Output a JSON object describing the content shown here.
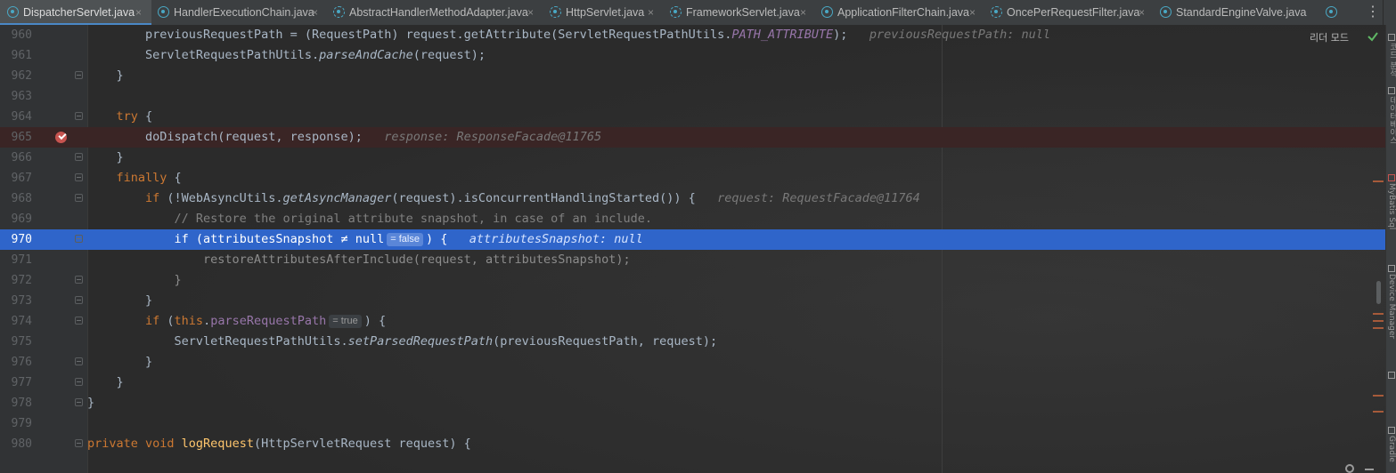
{
  "tabs": [
    {
      "label": "DispatcherServlet.java",
      "close": "×",
      "active": true
    },
    {
      "label": "HandlerExecutionChain.java",
      "close": "×"
    },
    {
      "label": "AbstractHandlerMethodAdapter.java",
      "close": "×"
    },
    {
      "label": "HttpServlet.java",
      "close": "×"
    },
    {
      "label": "FrameworkServlet.java",
      "close": "×"
    },
    {
      "label": "ApplicationFilterChain.java",
      "close": "×"
    },
    {
      "label": "OncePerRequestFilter.java",
      "close": "×"
    },
    {
      "label": "StandardEngineValve.java",
      "close": ""
    }
  ],
  "tab_more": "⋮",
  "reader_mode": "리더 모드",
  "side_labels": [
    "코드 분석",
    "데이터베이스",
    "MyBatis Sql",
    "Device Manager",
    "Gradle"
  ],
  "lines": [
    {
      "num": "960",
      "tokens": [
        [
          "",
          "        previousRequestPath = (RequestPath) request.getAttribute(ServletRequestPathUtils."
        ],
        [
          "const",
          "PATH_ATTRIBUTE"
        ],
        [
          "",
          ");"
        ]
      ],
      "hint": "previousRequestPath: null"
    },
    {
      "num": "961",
      "tokens": [
        [
          "",
          "        ServletRequestPathUtils."
        ],
        [
          "it",
          "parseAndCache"
        ],
        [
          "",
          "(request);"
        ]
      ]
    },
    {
      "num": "962",
      "tokens": [
        [
          "",
          "    }"
        ]
      ]
    },
    {
      "num": "963",
      "tokens": []
    },
    {
      "num": "964",
      "tokens": [
        [
          "kw",
          "    try"
        ],
        [
          "",
          " {"
        ]
      ]
    },
    {
      "num": "965",
      "tokens": [
        [
          "",
          "        doDispatch(request, response);"
        ]
      ],
      "hint": "response: ResponseFacade@11765",
      "breakpoint": true
    },
    {
      "num": "966",
      "tokens": [
        [
          "",
          "    }"
        ]
      ]
    },
    {
      "num": "967",
      "tokens": [
        [
          "kw",
          "    finally"
        ],
        [
          "",
          " {"
        ]
      ]
    },
    {
      "num": "968",
      "tokens": [
        [
          "kw",
          "        if"
        ],
        [
          "",
          " (!WebAsyncUtils."
        ],
        [
          "it",
          "getAsyncManager"
        ],
        [
          "",
          "(request).isConcurrentHandlingStarted()) {"
        ]
      ],
      "hint": "request: RequestFacade@11764"
    },
    {
      "num": "969",
      "tokens": [
        [
          "cmt",
          "            // Restore the original attribute snapshot, in case of an include."
        ]
      ]
    },
    {
      "num": "970",
      "tokens": [
        [
          "kw",
          "            if"
        ],
        [
          "",
          " (attributesSnapshot ≠ "
        ],
        [
          "kw",
          "null"
        ],
        [
          "chip",
          "= false"
        ],
        [
          "",
          ") {"
        ]
      ],
      "hint": "attributesSnapshot: null",
      "exec": true
    },
    {
      "num": "971",
      "tokens": [
        [
          "dim",
          "                restoreAttributesAfterInclude(request, attributesSnapshot);"
        ]
      ]
    },
    {
      "num": "972",
      "tokens": [
        [
          "dim",
          "            }"
        ]
      ]
    },
    {
      "num": "973",
      "tokens": [
        [
          "",
          "        }"
        ]
      ]
    },
    {
      "num": "974",
      "tokens": [
        [
          "kw",
          "        if"
        ],
        [
          "",
          " ("
        ],
        [
          "kw",
          "this"
        ],
        [
          "",
          "."
        ],
        [
          "field",
          "parseRequestPath"
        ],
        [
          "chip",
          "= true"
        ],
        [
          "",
          ") {"
        ]
      ]
    },
    {
      "num": "975",
      "tokens": [
        [
          "",
          "            ServletRequestPathUtils."
        ],
        [
          "it",
          "setParsedRequestPath"
        ],
        [
          "",
          "(previousRequestPath, request);"
        ]
      ]
    },
    {
      "num": "976",
      "tokens": [
        [
          "",
          "        }"
        ]
      ]
    },
    {
      "num": "977",
      "tokens": [
        [
          "",
          "    }"
        ]
      ]
    },
    {
      "num": "978",
      "tokens": [
        [
          "",
          "}"
        ]
      ]
    },
    {
      "num": "979",
      "tokens": []
    },
    {
      "num": "980",
      "tokens": [
        [
          "kw",
          "private void "
        ],
        [
          "fn",
          "logRequest"
        ],
        [
          "",
          "(HttpServletRequest request) {"
        ]
      ]
    }
  ],
  "colors": {
    "background": "#2b2b2b",
    "keyword": "#cc7832",
    "method_decl": "#ffc66d",
    "static_const": "#9876aa",
    "comment": "#808080",
    "exec_line": "#2f65ca",
    "breakpoint_line": "#3a2525",
    "breakpoint": "#c75450"
  }
}
